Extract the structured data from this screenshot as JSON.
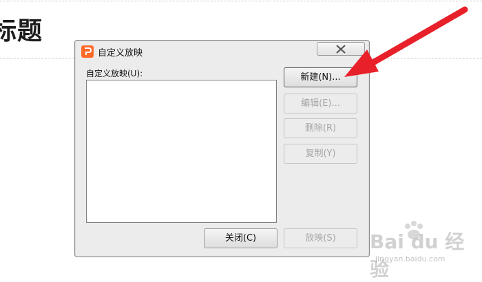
{
  "slide": {
    "title_fragment": "标题"
  },
  "dialog": {
    "title": "自定义放映",
    "list_label": "自定义放映(U):",
    "buttons": {
      "new": "新建(N)...",
      "edit": "编辑(E)...",
      "delete": "删除(R)",
      "copy": "复制(Y)",
      "close": "关闭(C)",
      "show": "放映(S)"
    }
  },
  "watermark": {
    "logo_text": "Bai du 经验",
    "url": "jingyan.baidu.com"
  },
  "colors": {
    "arrow": "#e8202a",
    "app_icon": "#ff6a2a"
  },
  "icons": [
    "wps-presentation-icon",
    "close-icon",
    "red-arrow-annotation",
    "baidu-paw-icon"
  ]
}
